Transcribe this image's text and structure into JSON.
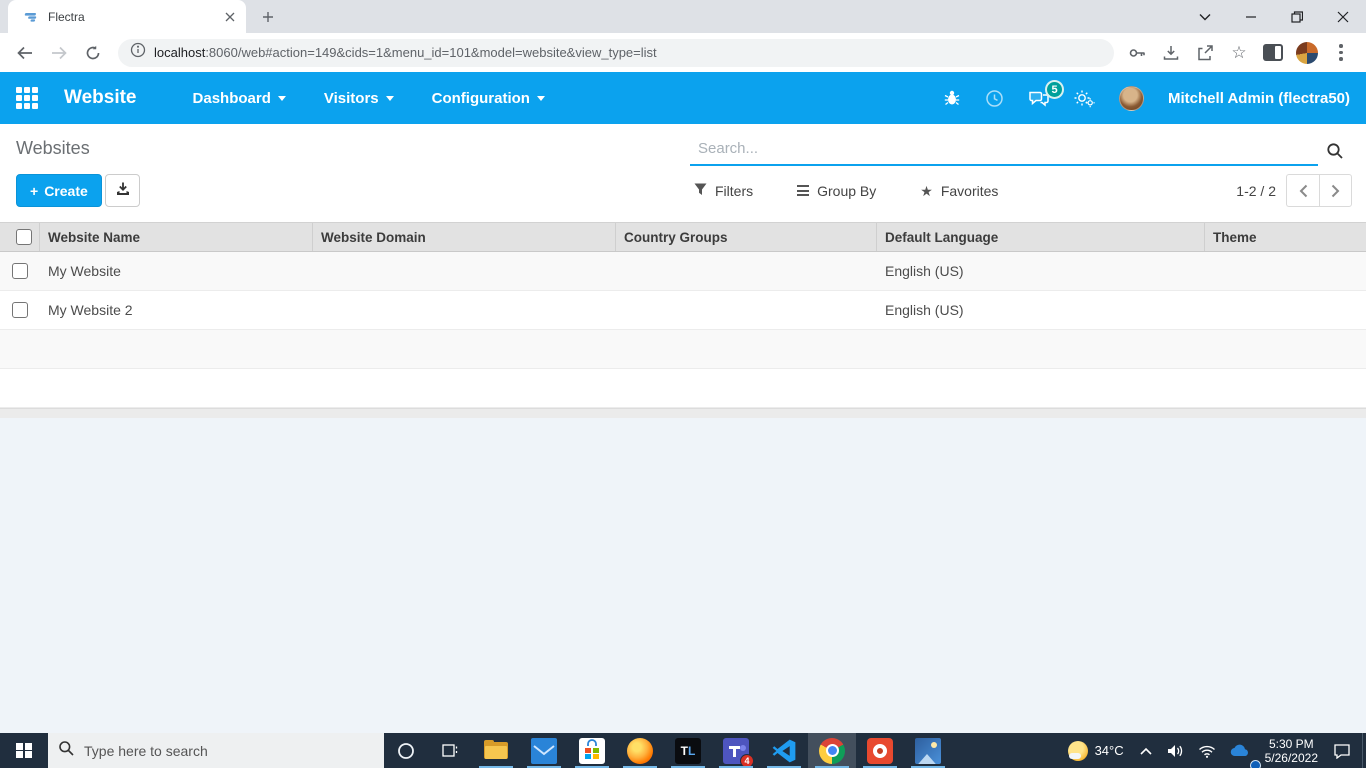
{
  "browser": {
    "tab_title": "Flectra",
    "url_host": "localhost",
    "url_rest": ":8060/web#action=149&cids=1&menu_id=101&model=website&view_type=list"
  },
  "appbar": {
    "app_name": "Website",
    "menus": [
      {
        "label": "Dashboard"
      },
      {
        "label": "Visitors"
      },
      {
        "label": "Configuration"
      }
    ],
    "messages_badge": "5",
    "user_name": "Mitchell Admin (flectra50)"
  },
  "control_panel": {
    "title": "Websites",
    "create_plus": "+",
    "create_label": "Create",
    "search_placeholder": "Search...",
    "filters_label": "Filters",
    "group_by_label": "Group By",
    "favorites_label": "Favorites",
    "pager_text": "1-2 / 2"
  },
  "table": {
    "columns": [
      "Website Name",
      "Website Domain",
      "Country Groups",
      "Default Language",
      "Theme"
    ],
    "rows": [
      {
        "website_name": "My Website",
        "website_domain": "",
        "country_groups": "",
        "default_language": "English (US)",
        "theme": ""
      },
      {
        "website_name": "My Website 2",
        "website_domain": "",
        "country_groups": "",
        "default_language": "English (US)",
        "theme": ""
      }
    ]
  },
  "taskbar": {
    "search_placeholder": "Type here to search",
    "tl_t": "T",
    "tl_l": "L",
    "teams_badge": "4",
    "temperature": "34°C",
    "clock_time": "5:30 PM",
    "clock_date": "5/26/2022"
  },
  "colors": {
    "accent_blue": "#0ba2ee",
    "badge_teal": "#00a09b",
    "taskbar_dark": "#202e3e",
    "tabbar_gray": "#dee1e6"
  }
}
